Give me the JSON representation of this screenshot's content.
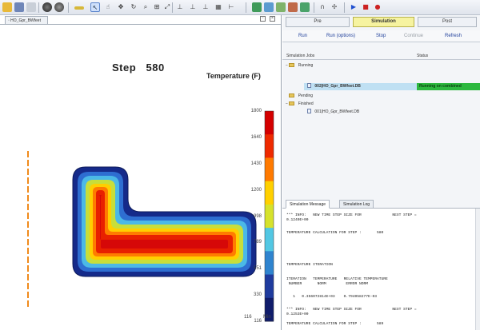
{
  "toolbar": {
    "icons": [
      "folder-open-icon",
      "save-icon",
      "save-as-icon",
      "sphere-icon",
      "sphere-alt-icon",
      "bracket-icon",
      "select-arrow-icon",
      "pointer-icon",
      "move-icon",
      "rotate-icon",
      "zoom-icon",
      "zoom-box-icon",
      "fit-icon",
      "axis-xz-icon",
      "axis-yz-icon",
      "axis-xy-icon",
      "grid-icon",
      "measure-icon",
      "image-icon",
      "view-icon",
      "table-icon",
      "chart-icon",
      "probe-icon",
      "magnet-icon",
      "settings-icon",
      "play-icon",
      "stop-icon",
      "record-icon"
    ],
    "colors": {
      "play": "#1f4fcf",
      "stop": "#cc2222",
      "record": "#cc2222"
    }
  },
  "viewport": {
    "tab_label": "HO_Gpr_BWfeet",
    "step_label": "Step",
    "step_value": "580",
    "legend_title": "Temperature (F)",
    "scale_min_caption": "116",
    "scale_max_caption": "Min",
    "legend_ticks": [
      "1800",
      "1640",
      "1430",
      "1200",
      "998",
      "789",
      "551",
      "330",
      "116"
    ],
    "legend_colors": [
      "#d40000",
      "#ee2a00",
      "#ff7a00",
      "#ffd000",
      "#d6e22c",
      "#52c7e3",
      "#2f84cf",
      "#1f3b9e",
      "#101c6b"
    ],
    "contour_colors": [
      "#152a8a",
      "#2e6ed1",
      "#4bb9e6",
      "#c8de3a",
      "#ffcf00",
      "#ff7c00",
      "#e82000",
      "#d60808"
    ]
  },
  "panel": {
    "tabs": [
      {
        "label": "Pre",
        "active": false
      },
      {
        "label": "Simulation",
        "active": true
      },
      {
        "label": "Post",
        "active": false
      }
    ],
    "actions": [
      {
        "label": "Run",
        "enabled": true
      },
      {
        "label": "Run (options)",
        "enabled": true
      },
      {
        "label": "Stop",
        "enabled": true
      },
      {
        "label": "Continue",
        "enabled": false
      },
      {
        "label": "Refresh",
        "enabled": true
      }
    ],
    "jobs_header": {
      "col1": "Simulation Jobs",
      "col2": "Status"
    },
    "tree": {
      "running_label": "Running",
      "running_job": "002|HO_Gpr_BWfeet.DB",
      "running_status": "Running on combined",
      "pending_label": "Pending",
      "finished_label": "Finished",
      "finished_job": "001|HO_Gpr_BWfeet.DB"
    }
  },
  "messages": {
    "tabs": [
      {
        "label": "Simulation Message",
        "active": true
      },
      {
        "label": "Simulation Log",
        "active": false
      }
    ],
    "lines": [
      "*** INFO:   NEW TIME STEP SIZE FOR              NEXT STEP =",
      "0.1240E+00",
      "",
      "TEMPERATURE CALCULATION FOR STEP :       580",
      "",
      "",
      "TEMPERATURE ITERATION",
      "",
      "ITERATION   TEMPERATURE   RELATIVE TEMPERATURE",
      " NUMBER       NORM         ERROR NORM",
      "",
      "   1   0.356072814E+03    0.794058277E-03",
      "",
      "*** INFO:   NEW TIME STEP SIZE FOR              NEXT STEP =",
      "0.1253E+00",
      "",
      "TEMPERATURE CALCULATION FOR STEP :       589"
    ]
  }
}
